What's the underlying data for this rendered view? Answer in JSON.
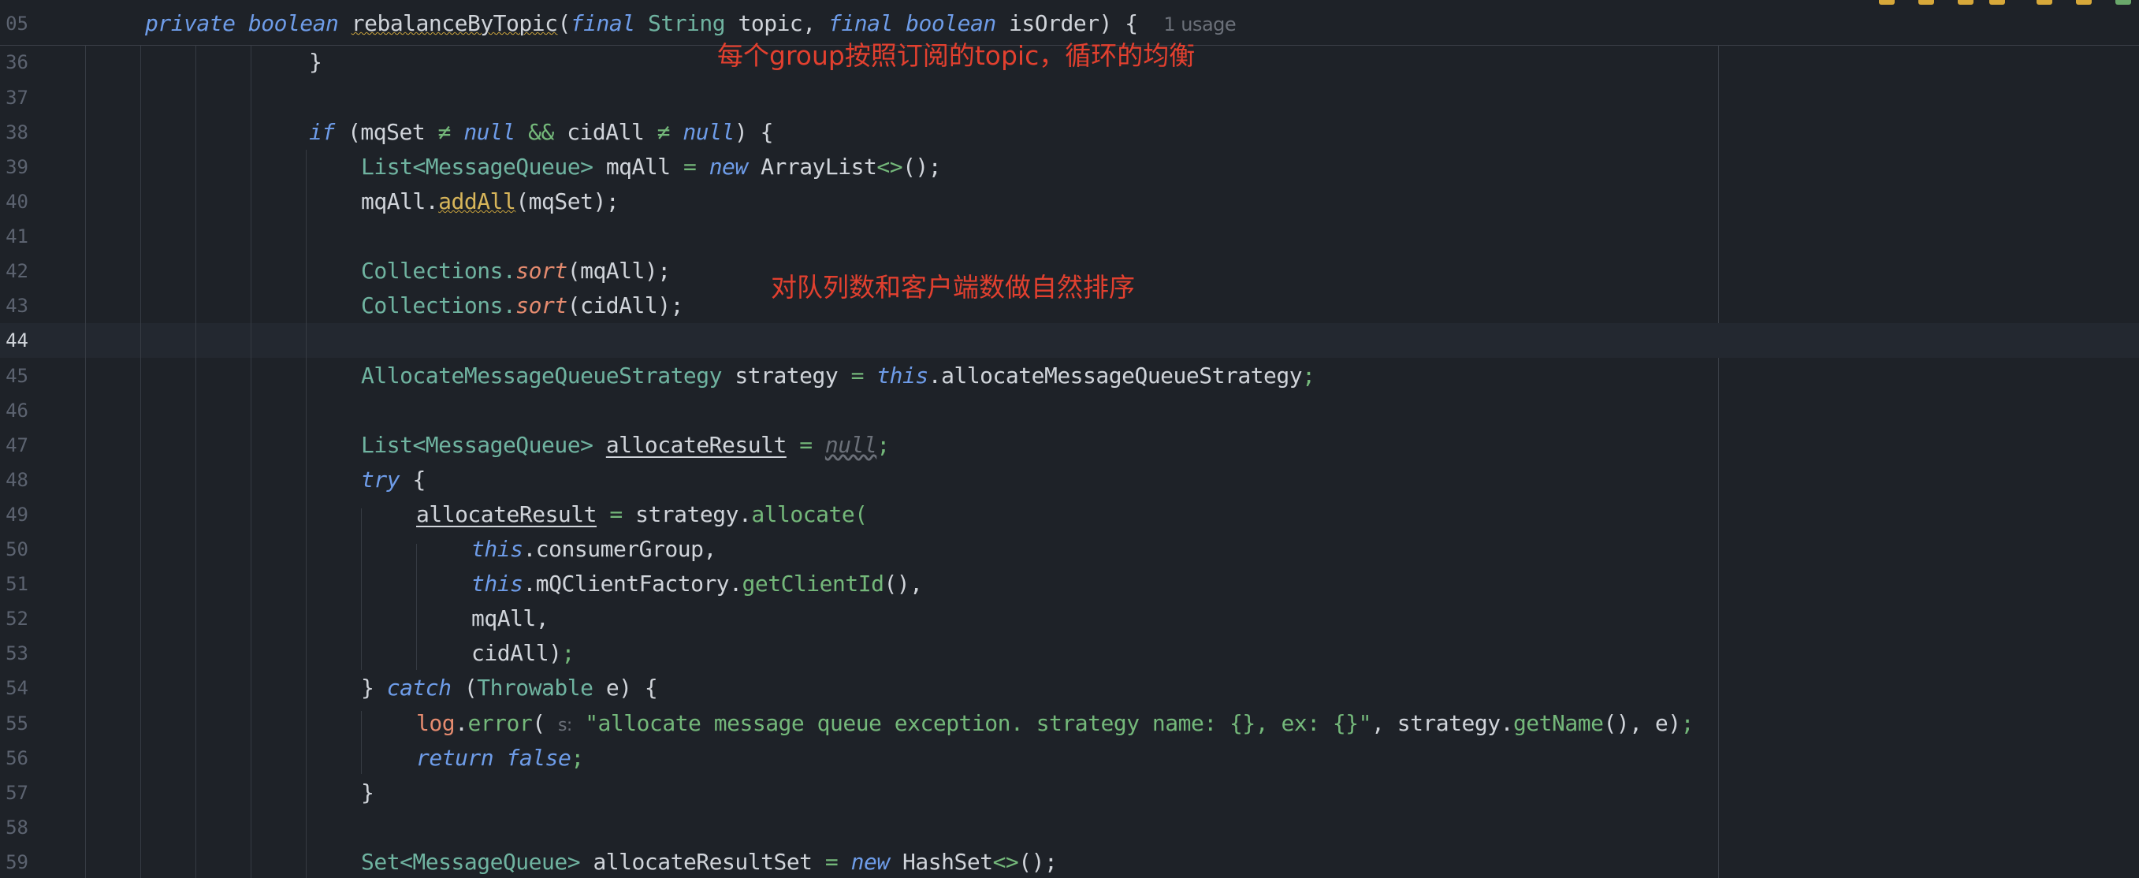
{
  "editor": {
    "sticky_header": {
      "line_number": "05",
      "usage_hint": "1 usage"
    },
    "current_line_number": "44",
    "annotations": {
      "topic_balance": "每个group按照订阅的topic，循环的均衡",
      "natural_sort": "对队列数和客户端数做自然排序"
    },
    "lines": [
      {
        "num": "36"
      },
      {
        "num": "37"
      },
      {
        "num": "38"
      },
      {
        "num": "39"
      },
      {
        "num": "40"
      },
      {
        "num": "41"
      },
      {
        "num": "42"
      },
      {
        "num": "43"
      },
      {
        "num": "44"
      },
      {
        "num": "45"
      },
      {
        "num": "46"
      },
      {
        "num": "47"
      },
      {
        "num": "48"
      },
      {
        "num": "49"
      },
      {
        "num": "50"
      },
      {
        "num": "51"
      },
      {
        "num": "52"
      },
      {
        "num": "53"
      },
      {
        "num": "54"
      },
      {
        "num": "55"
      },
      {
        "num": "56"
      },
      {
        "num": "57"
      },
      {
        "num": "58"
      },
      {
        "num": "59"
      }
    ],
    "code": {
      "sig": {
        "private": "private",
        "boolean": "boolean",
        "method_name": "rebalanceByTopic",
        "open_paren": "(",
        "final1": "final",
        "string_type": "String",
        "param1": "topic,",
        "final2": "final",
        "boolean2": "boolean",
        "param2": "isOrder) {"
      },
      "l36": "}",
      "l38": {
        "if": "if",
        "open": "(mqSet",
        "neq1": "≠",
        "null1": "null",
        "and": "&&",
        "cid": "cidAll",
        "neq2": "≠",
        "null2": "null",
        "close": ") {"
      },
      "l39": {
        "list": "List",
        "generic": "<MessageQueue>",
        "var": "mqAll",
        "eq": "=",
        "new": "new",
        "cls": "ArrayList",
        "diamond": "<>",
        "end": "();"
      },
      "l40": {
        "obj": "mqAll.",
        "method": "addAll",
        "args": "(mqSet);"
      },
      "l42": {
        "cls": "Collections.",
        "method": "sort",
        "args": "(mqAll);"
      },
      "l43": {
        "cls": "Collections.",
        "method": "sort",
        "args": "(cidAll);"
      },
      "l45": {
        "type": "AllocateMessageQueueStrategy",
        "var": "strategy",
        "eq": "=",
        "this": "this",
        "rest": ".allocateMessageQueueStrategy",
        "semi": ";"
      },
      "l47": {
        "list": "List",
        "generic": "<MessageQueue>",
        "var": "allocateResult",
        "eq": "=",
        "null": "null",
        "semi": ";"
      },
      "l48": {
        "try": "try",
        "brace": "{"
      },
      "l49": {
        "var": "allocateResult",
        "eq": "=",
        "obj": "strategy.",
        "method": "allocate",
        "open": "("
      },
      "l50": {
        "this": "this",
        "rest": ".consumerGroup,"
      },
      "l51": {
        "this": "this",
        "rest": ".mQClientFactory.",
        "method": "getClientId",
        "end": "(),"
      },
      "l52": "mqAll,",
      "l53": {
        "arg": "cidAll)",
        "semi": ";"
      },
      "l54": {
        "brace": "}",
        "catch": "catch",
        "open": "(",
        "type": "Throwable",
        "var": "e) {"
      },
      "l55": {
        "log": "log",
        "dot": ".",
        "method": "error",
        "open": "(",
        "hint": "s:",
        "str": "\"allocate message queue exception. strategy name: {}, ex: {}\"",
        "comma": ", strategy.",
        "method2": "getName",
        "end": "(), e)",
        "semi": ";"
      },
      "l56": {
        "return": "return",
        "false": "false",
        "semi": ";"
      },
      "l57": "}",
      "l59": {
        "set": "Set",
        "generic": "<MessageQueue>",
        "var": "allocateResultSet",
        "eq": "=",
        "new": "new",
        "cls": "HashSet",
        "diamond": "<>",
        "end": "();"
      }
    },
    "colors": {
      "background": "#1e2228",
      "keyword": "#6e9ce8",
      "type": "#6fb3a0",
      "method_call": "#74b87a",
      "static_method": "#e58b6f",
      "annotation_red": "#e2402f"
    }
  }
}
